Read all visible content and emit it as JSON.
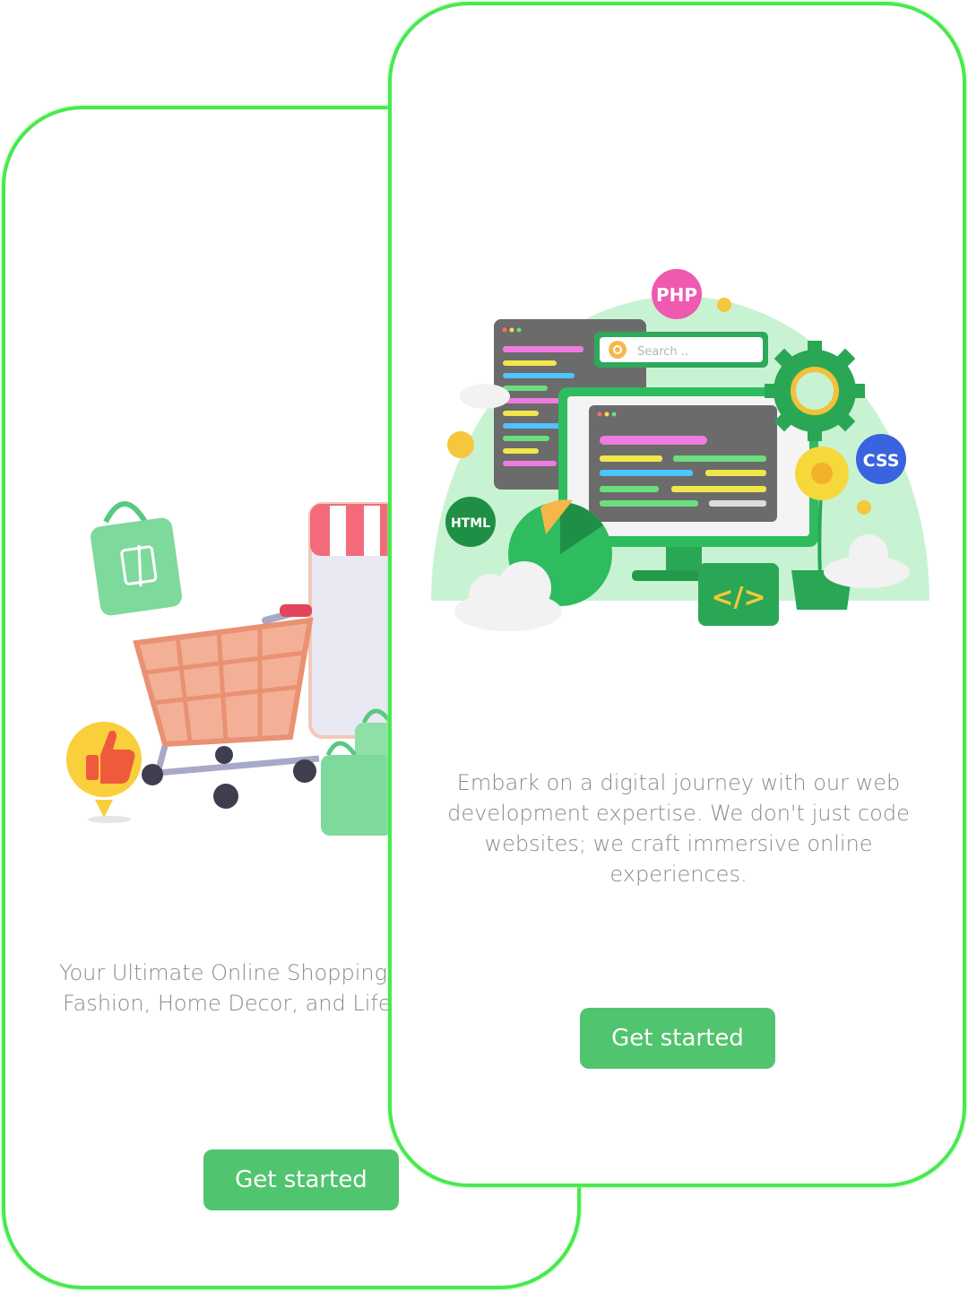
{
  "screens": {
    "shopping": {
      "illustration": "shopping-cart-illustration",
      "caption_line1": "Your Ultimate Online Shopping",
      "caption_line2": "Fashion, Home Decor, and Lifest",
      "cta_label": "Get started"
    },
    "webdev": {
      "illustration": "web-development-illustration",
      "caption": "Embark on a digital journey with our web development expertise. We don't just code websites; we craft immersive online experiences.",
      "cta_label": "Get started",
      "badges": {
        "php": "PHP",
        "css": "CSS",
        "html": "HTML",
        "search_placeholder": "Search ..",
        "code_tag": "</>"
      }
    }
  },
  "colors": {
    "frame_border": "#49e84f",
    "button": "#51c46f",
    "caption_text": "#8a8a8a"
  }
}
